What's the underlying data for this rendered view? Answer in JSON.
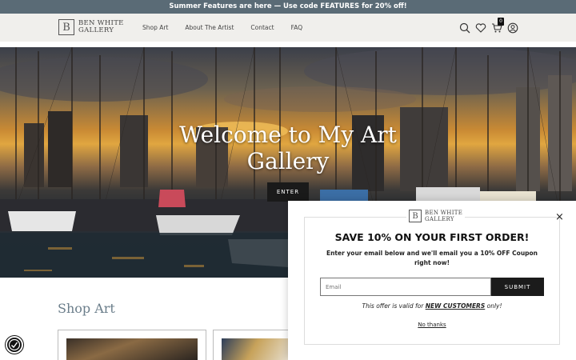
{
  "promo": {
    "text": "Summer Features are here — Use code FEATURES for 20% off!"
  },
  "header": {
    "logo_letter": "B",
    "logo_line1": "BEN WHITE",
    "logo_line2": "GALLERY",
    "nav": [
      "Shop Art",
      "About The Artist",
      "Contact",
      "FAQ"
    ],
    "cart_count": "0",
    "icons": [
      "search-icon",
      "heart-icon",
      "cart-icon",
      "account-icon"
    ]
  },
  "hero": {
    "title": "Welcome to My Art Gallery",
    "button": "ENTER"
  },
  "shop": {
    "title": "Shop Art"
  },
  "popup": {
    "logo_letter": "B",
    "logo_line1": "BEN WHITE",
    "logo_line2": "GALLERY",
    "close": "×",
    "title": "SAVE 10% ON YOUR FIRST ORDER!",
    "text": "Enter your email below and we'll email you a 10% OFF Coupon right now!",
    "email_placeholder": "Email",
    "submit": "SUBMIT",
    "offer_before": "This offer is valid for ",
    "offer_highlight": "NEW CUSTOMERS",
    "offer_after": " only!",
    "no_thanks": "No thanks"
  },
  "colors": {
    "promo_bar": "#5a6b76",
    "header_bg": "#f0efec",
    "shop_title": "#6a7d8a",
    "button": "#1a1a1a"
  }
}
